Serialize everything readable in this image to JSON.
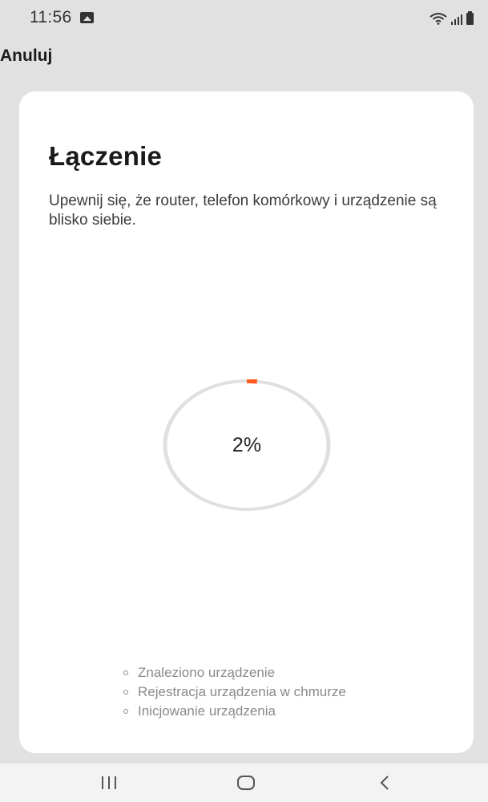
{
  "status_bar": {
    "time": "11:56",
    "icons": [
      "image-icon",
      "wifi-icon",
      "signal-icon",
      "battery-icon"
    ]
  },
  "header": {
    "cancel_label": "Anuluj"
  },
  "card": {
    "title": "Łączenie",
    "description": "Upewnij się, że router, telefon komórkowy i urządzenie są blisko siebie.",
    "progress": {
      "percent": 2,
      "label": "2%",
      "track_color": "#e0e0e0",
      "fill_color": "#ff5a1f"
    },
    "steps": [
      "Znaleziono urządzenie",
      "Rejestracja urządzenia w chmurze",
      "Inicjowanie urządzenia"
    ]
  },
  "nav_bar": {
    "buttons": [
      "recent-apps-icon",
      "home-icon",
      "back-icon"
    ]
  }
}
